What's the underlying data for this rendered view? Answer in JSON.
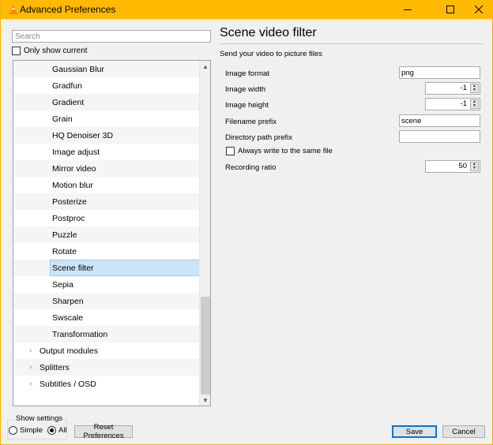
{
  "window": {
    "title": "Advanced Preferences",
    "accent_color": "#ffb900",
    "controls": {
      "minimize": "minimize-icon",
      "maximize": "maximize-icon",
      "close": "close-icon"
    }
  },
  "sidebar": {
    "search_placeholder": "Search",
    "search_value": "",
    "only_show_current_label": "Only show current",
    "only_show_current_checked": false,
    "tree_items": [
      {
        "label": "Gaussian Blur",
        "level": 2
      },
      {
        "label": "Gradfun",
        "level": 2
      },
      {
        "label": "Gradient",
        "level": 2
      },
      {
        "label": "Grain",
        "level": 2
      },
      {
        "label": "HQ Denoiser 3D",
        "level": 2
      },
      {
        "label": "Image adjust",
        "level": 2
      },
      {
        "label": "Mirror video",
        "level": 2
      },
      {
        "label": "Motion blur",
        "level": 2
      },
      {
        "label": "Posterize",
        "level": 2
      },
      {
        "label": "Postproc",
        "level": 2
      },
      {
        "label": "Puzzle",
        "level": 2
      },
      {
        "label": "Rotate",
        "level": 2
      },
      {
        "label": "Scene filter",
        "level": 2,
        "selected": true
      },
      {
        "label": "Sepia",
        "level": 2
      },
      {
        "label": "Sharpen",
        "level": 2
      },
      {
        "label": "Swscale",
        "level": 2
      },
      {
        "label": "Transformation",
        "level": 2
      },
      {
        "label": "Output modules",
        "level": 1,
        "expandable": true
      },
      {
        "label": "Splitters",
        "level": 1,
        "expandable": true
      },
      {
        "label": "Subtitles / OSD",
        "level": 1,
        "expandable": true
      }
    ]
  },
  "panel": {
    "title": "Scene video filter",
    "description": "Send your video to picture files",
    "fields": {
      "image_format": {
        "label": "Image format",
        "value": "png"
      },
      "image_width": {
        "label": "Image width",
        "value": "-1"
      },
      "image_height": {
        "label": "Image height",
        "value": "-1"
      },
      "filename_prefix": {
        "label": "Filename prefix",
        "value": "scene"
      },
      "directory_path_prefix": {
        "label": "Directory path prefix",
        "value": ""
      },
      "always_write_same_file": {
        "label": "Always write to the same file",
        "checked": false
      },
      "recording_ratio": {
        "label": "Recording ratio",
        "value": "50"
      }
    }
  },
  "footer": {
    "show_settings_label": "Show settings",
    "simple_label": "Simple",
    "all_label": "All",
    "selected_mode": "All",
    "reset_label": "Reset Preferences",
    "save_label": "Save",
    "cancel_label": "Cancel"
  }
}
